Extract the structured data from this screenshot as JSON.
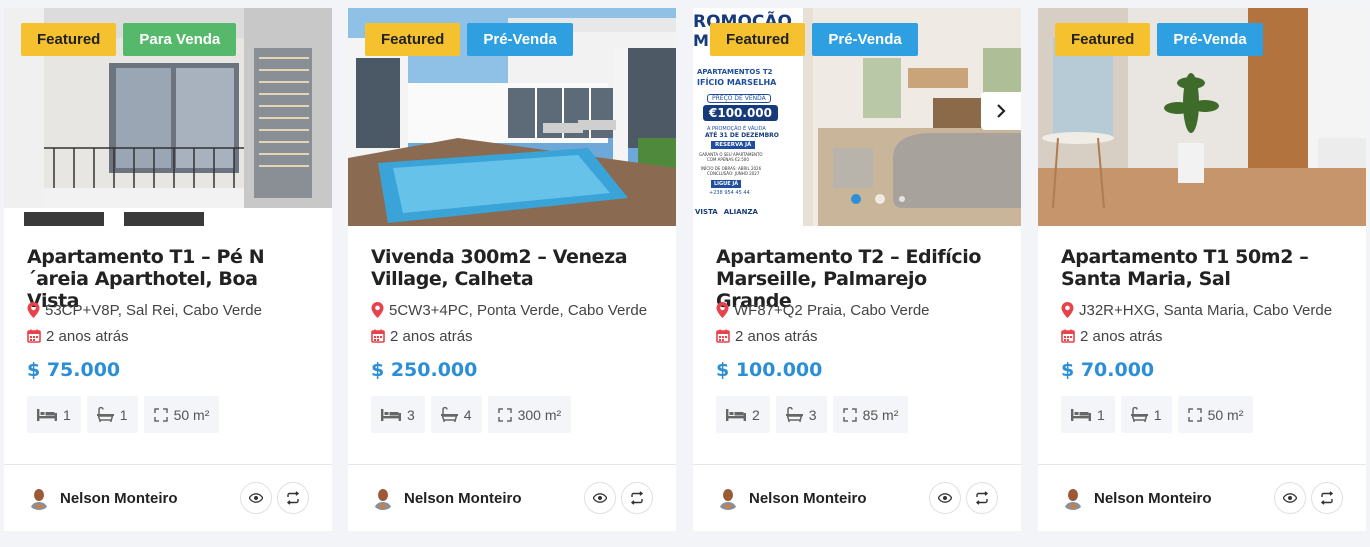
{
  "colors": {
    "featured": "#f5c12e",
    "para_venda": "#55b86a",
    "pre_venda": "#2e9fe0",
    "price": "#2c8fd6",
    "pin": "#e8424b"
  },
  "icons": {
    "location": "map-pin-icon",
    "date": "calendar-icon",
    "beds": "bed-icon",
    "baths": "bath-icon",
    "area": "area-expand-icon",
    "view": "eye-icon",
    "compare": "compare-icon",
    "next": "chevron-right-icon"
  },
  "cards": [
    {
      "featured": "Featured",
      "status": "Para Venda",
      "status_color": "#55b86a",
      "title": "Apartamento T1 – Pé N´areia Aparthotel, Boa Vista",
      "address": "53CP+V8P, Sal Rei, Cabo Verde",
      "date": "2 anos atrás",
      "price": "$ 75.000",
      "beds": "1",
      "baths": "1",
      "area": "50 m²",
      "agent": "Nelson Monteiro"
    },
    {
      "featured": "Featured",
      "status": "Pré-Venda",
      "status_color": "#2e9fe0",
      "title": "Vivenda 300m2 – Veneza Village, Calheta",
      "address": "5CW3+4PC, Ponta Verde, Cabo Verde",
      "date": "2 anos atrás",
      "price": "$ 250.000",
      "beds": "3",
      "baths": "4",
      "area": "300 m²",
      "agent": "Nelson Monteiro"
    },
    {
      "featured": "Featured",
      "status": "Pré-Venda",
      "status_color": "#2e9fe0",
      "title": "Apartamento T2 – Edifício Marseille, Palmarejo Grande",
      "address": "WF87+Q2 Praia, Cabo Verde",
      "date": "2 anos atrás",
      "price": "$ 100.000",
      "beds": "2",
      "baths": "3",
      "area": "85 m²",
      "agent": "Nelson Monteiro",
      "promo": {
        "headline_1": "ROMOÇÃO",
        "headline_2": "MPERDÍVEL",
        "sub_1": "APARTAMENTOS T2",
        "sub_2": "IFÍCIO MARSELHA",
        "price_label": "PREÇO DE VENDA",
        "price": "€100.000",
        "promo_note_1": "A PROMOÇÃO É VÁLIDA",
        "promo_note_2": "ATÉ 31 DE DEZEMBRO",
        "reserve": "RESERVA JÁ",
        "guarantee_1": "GARANTA O SEU APARTAMENTO",
        "guarantee_2": "COM APENAS €2.500",
        "works_1": "INÍCIO DE OBRAS: ABRIL 2026",
        "works_2": "CONCLUSÃO: JUNHO 2027",
        "call": "LIGUE JÁ",
        "phone": "+238 954 45 44",
        "brand_1": "VISTA",
        "brand_2": "ALIANZA"
      }
    },
    {
      "featured": "Featured",
      "status": "Pré-Venda",
      "status_color": "#2e9fe0",
      "title": "Apartamento T1 50m2 – Santa Maria, Sal",
      "address": "J32R+HXG, Santa Maria, Cabo Verde",
      "date": "2 anos atrás",
      "price": "$ 70.000",
      "beds": "1",
      "baths": "1",
      "area": "50 m²",
      "agent": "Nelson Monteiro"
    }
  ]
}
